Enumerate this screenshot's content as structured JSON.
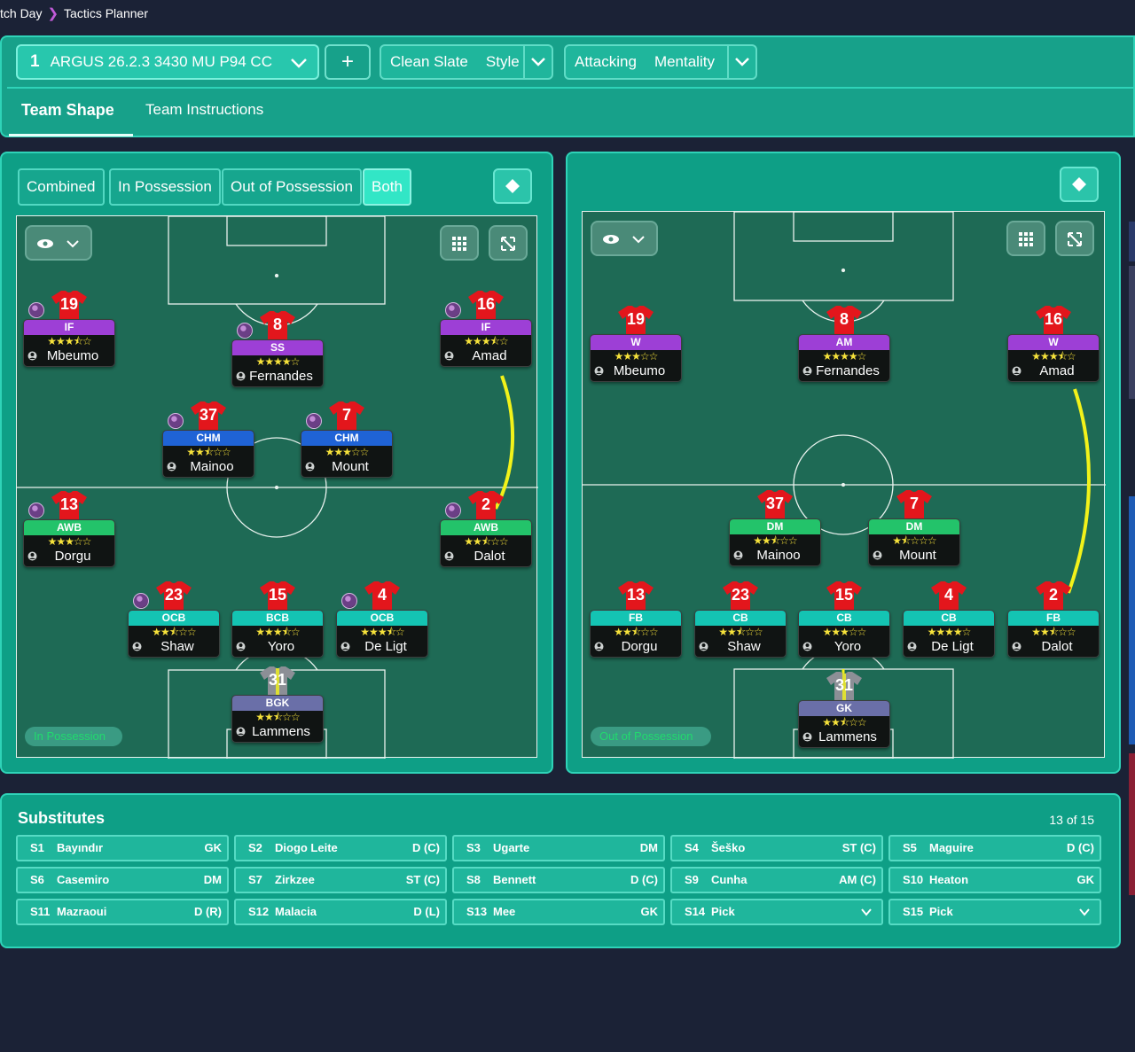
{
  "breadcrumb": {
    "parent": "tch Day",
    "current": "Tactics Planner"
  },
  "tactic": {
    "number": "1",
    "name": "ARGUS 26.2.3 3430 MU P94 CC",
    "add_label": "+"
  },
  "style": {
    "value": "Clean Slate",
    "label": "Style"
  },
  "mentality": {
    "value": "Attacking",
    "label": "Mentality"
  },
  "tabs": [
    "Team Shape",
    "Team Instructions"
  ],
  "phase_buttons": [
    "Combined",
    "In Possession",
    "Out of Possession",
    "Both"
  ],
  "left_pitch": {
    "label": "In Possession",
    "players": [
      {
        "num": "19",
        "role": "IF",
        "name": "Mbeumo",
        "stars": "★★★⯪☆",
        "role_color": "#9d3fd6",
        "ball": true
      },
      {
        "num": "8",
        "role": "SS",
        "name": "Fernandes",
        "stars": "★★★★☆",
        "role_color": "#9d3fd6",
        "ball": true
      },
      {
        "num": "16",
        "role": "IF",
        "name": "Amad",
        "stars": "★★★⯪☆",
        "role_color": "#9d3fd6",
        "ball": true
      },
      {
        "num": "37",
        "role": "CHM",
        "name": "Mainoo",
        "stars": "★★⯪☆☆",
        "role_color": "#1f63d6",
        "ball": true
      },
      {
        "num": "7",
        "role": "CHM",
        "name": "Mount",
        "stars": "★★★☆☆",
        "role_color": "#1f63d6",
        "ball": true
      },
      {
        "num": "13",
        "role": "AWB",
        "name": "Dorgu",
        "stars": "★★★☆☆",
        "role_color": "#23c36a",
        "ball": true
      },
      {
        "num": "2",
        "role": "AWB",
        "name": "Dalot",
        "stars": "★★⯪☆☆",
        "role_color": "#23c36a",
        "ball": true
      },
      {
        "num": "23",
        "role": "OCB",
        "name": "Shaw",
        "stars": "★★⯪☆☆",
        "role_color": "#14c4b3",
        "ball": true
      },
      {
        "num": "15",
        "role": "BCB",
        "name": "Yoro",
        "stars": "★★★⯪☆",
        "role_color": "#14c4b3",
        "ball": false
      },
      {
        "num": "4",
        "role": "OCB",
        "name": "De Ligt",
        "stars": "★★★⯪☆",
        "role_color": "#14c4b3",
        "ball": true
      },
      {
        "num": "31",
        "role": "BGK",
        "name": "Lammens",
        "stars": "★★⯪☆☆",
        "role_color": "#6a6fa8",
        "ball": false
      }
    ]
  },
  "right_pitch": {
    "label": "Out of Possession",
    "players": [
      {
        "num": "19",
        "role": "W",
        "name": "Mbeumo",
        "stars": "★★★☆☆",
        "role_color": "#9d3fd6"
      },
      {
        "num": "8",
        "role": "AM",
        "name": "Fernandes",
        "stars": "★★★★☆",
        "role_color": "#9d3fd6"
      },
      {
        "num": "16",
        "role": "W",
        "name": "Amad",
        "stars": "★★★⯪☆",
        "role_color": "#9d3fd6"
      },
      {
        "num": "37",
        "role": "DM",
        "name": "Mainoo",
        "stars": "★★⯪☆☆",
        "role_color": "#23c36a"
      },
      {
        "num": "7",
        "role": "DM",
        "name": "Mount",
        "stars": "★⯪☆☆☆",
        "role_color": "#23c36a"
      },
      {
        "num": "13",
        "role": "FB",
        "name": "Dorgu",
        "stars": "★★⯪☆☆",
        "role_color": "#14c4b3"
      },
      {
        "num": "23",
        "role": "CB",
        "name": "Shaw",
        "stars": "★★⯪☆☆",
        "role_color": "#14c4b3"
      },
      {
        "num": "15",
        "role": "CB",
        "name": "Yoro",
        "stars": "★★★☆☆",
        "role_color": "#14c4b3"
      },
      {
        "num": "4",
        "role": "CB",
        "name": "De Ligt",
        "stars": "★★★★☆",
        "role_color": "#14c4b3"
      },
      {
        "num": "2",
        "role": "FB",
        "name": "Dalot",
        "stars": "★★⯪☆☆",
        "role_color": "#14c4b3"
      },
      {
        "num": "31",
        "role": "GK",
        "name": "Lammens",
        "stars": "★★⯪☆☆",
        "role_color": "#6a6fa8"
      }
    ]
  },
  "substitutes": {
    "title": "Substitutes",
    "count": "13 of 15",
    "items": [
      {
        "slot": "S1",
        "name": "Bayındır",
        "pos": "GK"
      },
      {
        "slot": "S2",
        "name": "Diogo Leite",
        "pos": "D (C)"
      },
      {
        "slot": "S3",
        "name": "Ugarte",
        "pos": "DM"
      },
      {
        "slot": "S4",
        "name": "Šeško",
        "pos": "ST (C)"
      },
      {
        "slot": "S5",
        "name": "Maguire",
        "pos": "D (C)"
      },
      {
        "slot": "S6",
        "name": "Casemiro",
        "pos": "DM"
      },
      {
        "slot": "S7",
        "name": "Zirkzee",
        "pos": "ST (C)"
      },
      {
        "slot": "S8",
        "name": "Bennett",
        "pos": "D (C)"
      },
      {
        "slot": "S9",
        "name": "Cunha",
        "pos": "AM (C)"
      },
      {
        "slot": "S10",
        "name": "Heaton",
        "pos": "GK"
      },
      {
        "slot": "S11",
        "name": "Mazraoui",
        "pos": "D (R)"
      },
      {
        "slot": "S12",
        "name": "Malacia",
        "pos": "D (L)"
      },
      {
        "slot": "S13",
        "name": "Mee",
        "pos": "GK"
      },
      {
        "slot": "S14",
        "name": "Pick",
        "pos": ""
      },
      {
        "slot": "S15",
        "name": "Pick",
        "pos": ""
      }
    ]
  },
  "colors": {
    "panel": "#0e9f86",
    "pitch": "#1e6a55",
    "shirt": "#e3161c",
    "link_line": "#f2f21a",
    "background": "#1b2236"
  }
}
